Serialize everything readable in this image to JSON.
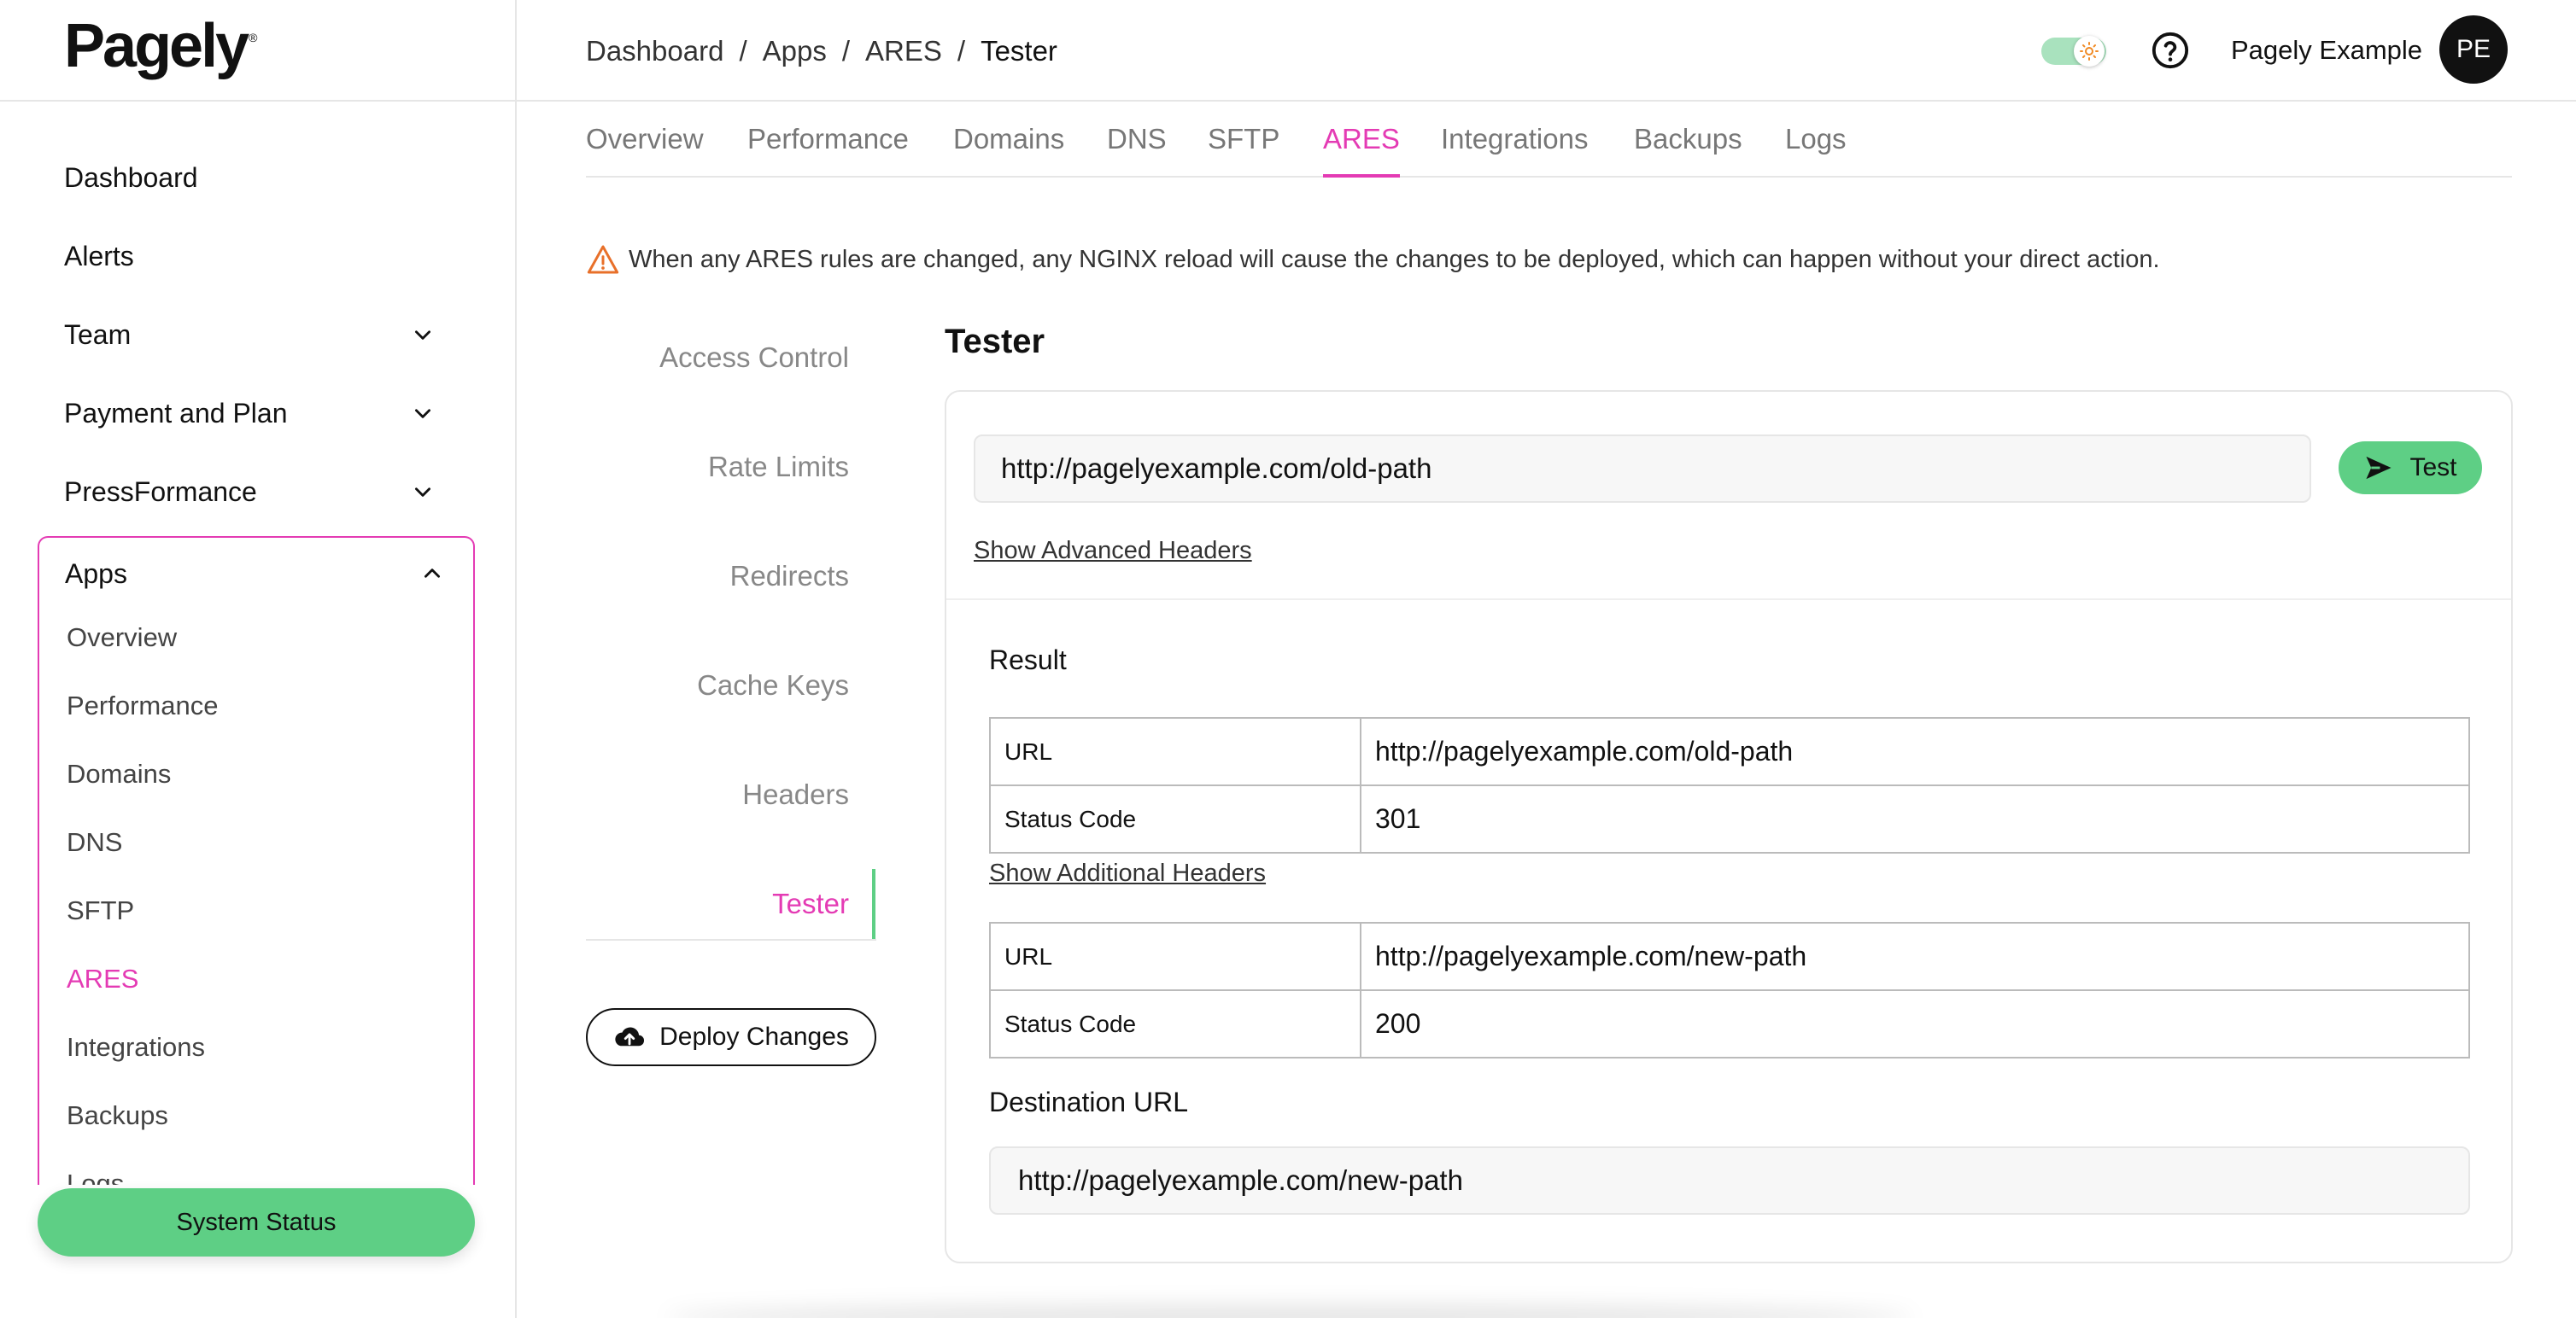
{
  "brand": {
    "logo_text": "Pagely",
    "logo_mark": "®"
  },
  "sidebar": {
    "items": [
      {
        "label": "Dashboard"
      },
      {
        "label": "Alerts"
      },
      {
        "label": "Team"
      },
      {
        "label": "Payment and Plan"
      },
      {
        "label": "PressFormance"
      }
    ],
    "apps": {
      "label": "Apps",
      "sub_items": [
        {
          "label": "Overview"
        },
        {
          "label": "Performance"
        },
        {
          "label": "Domains"
        },
        {
          "label": "DNS"
        },
        {
          "label": "SFTP"
        },
        {
          "label": "ARES",
          "active": true
        },
        {
          "label": "Integrations"
        },
        {
          "label": "Backups"
        },
        {
          "label": "Logs"
        }
      ]
    },
    "system_status_label": "System Status",
    "accent_color": "#e43bb4",
    "status_color": "#5ecf85"
  },
  "header": {
    "breadcrumb": [
      "Dashboard",
      "Apps",
      "ARES",
      "Tester"
    ],
    "breadcrumb_separator": "/",
    "user_name": "Pagely Example",
    "avatar_initials": "PE"
  },
  "tabs": [
    {
      "label": "Overview"
    },
    {
      "label": "Performance"
    },
    {
      "label": "Domains"
    },
    {
      "label": "DNS"
    },
    {
      "label": "SFTP"
    },
    {
      "label": "ARES",
      "active": true
    },
    {
      "label": "Integrations"
    },
    {
      "label": "Backups"
    },
    {
      "label": "Logs"
    }
  ],
  "warning": {
    "icon": "warning-triangle-icon",
    "text": "When any ARES rules are changed, any NGINX reload will cause the changes to be deployed, which can happen without your direct action."
  },
  "ares_nav": {
    "items": [
      {
        "label": "Access Control"
      },
      {
        "label": "Rate Limits"
      },
      {
        "label": "Redirects"
      },
      {
        "label": "Cache Keys"
      },
      {
        "label": "Headers"
      },
      {
        "label": "Tester",
        "active": true
      }
    ],
    "deploy_label": "Deploy Changes"
  },
  "tester": {
    "title": "Tester",
    "url_value": "http://pagelyexample.com/old-path",
    "test_button_label": "Test",
    "show_advanced_headers": "Show Advanced Headers",
    "result_label": "Result",
    "first_response": [
      {
        "key": "URL",
        "value": "http://pagelyexample.com/old-path"
      },
      {
        "key": "Status Code",
        "value": "301"
      }
    ],
    "show_additional_headers": "Show Additional Headers",
    "second_response": [
      {
        "key": "URL",
        "value": "http://pagelyexample.com/new-path"
      },
      {
        "key": "Status Code",
        "value": "200"
      }
    ],
    "destination_label": "Destination URL",
    "destination_value": "http://pagelyexample.com/new-path"
  }
}
